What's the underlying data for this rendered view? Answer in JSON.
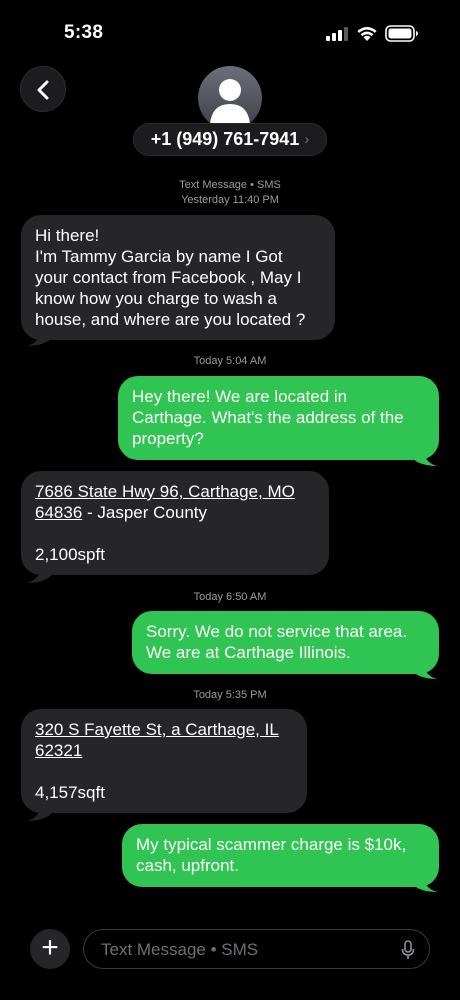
{
  "status_bar": {
    "time": "5:38"
  },
  "header": {
    "contact_number": "+1 (949) 761-7941",
    "chevron": "›"
  },
  "messages": {
    "service": "Text Message • SMS",
    "ts1": "Yesterday 11:40 PM",
    "m1_lines": [
      "Hi there!",
      "I'm Tammy Garcia by name I Got",
      "your contact from Facebook , May I",
      "know how you charge to wash a",
      "house, and where are you located  ?"
    ],
    "ts2": "Today 5:04 AM",
    "m2_lines": [
      "Hey there! We are located in",
      "Carthage. What's the address of the",
      "property?"
    ],
    "m3_link1": "7686 State Hwy 96, Carthage, MO",
    "m3_link2": "64836",
    "m3_rest": " - Jasper County",
    "m3_size": "2,100spft",
    "ts3": "Today 6:50 AM",
    "m4_lines": [
      "Sorry. We do not service that area.",
      "We are at Carthage Illinois."
    ],
    "ts4": "Today 5:35 PM",
    "m5_link1": "320 S Fayette St, a Carthage, IL",
    "m5_link2": "62321",
    "m5_size": "4,157sqft",
    "m6_lines": [
      "My typical scammer charge is $10k,",
      "cash, upfront."
    ]
  },
  "composer": {
    "placeholder": "Text Message • SMS",
    "plus": "+"
  },
  "icons": {
    "back": "chevron-left-icon",
    "mic": "microphone-icon",
    "plus": "plus-icon"
  },
  "colors": {
    "incoming": "#262628",
    "outgoing": "#30c552",
    "background": "#000000"
  }
}
